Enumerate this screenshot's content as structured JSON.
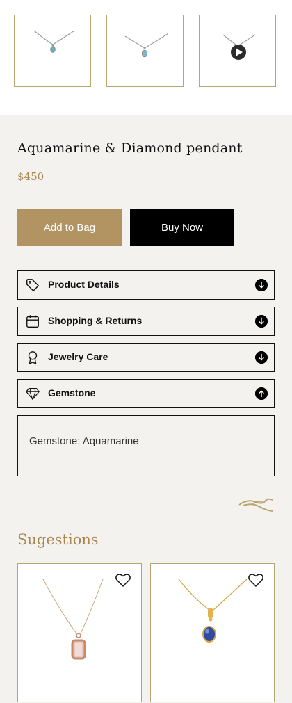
{
  "gallery": {
    "thumbnails": [
      {
        "icon": "pendant-aquamarine-front"
      },
      {
        "icon": "pendant-aquamarine-side"
      },
      {
        "icon": "play-video-icon"
      }
    ]
  },
  "product": {
    "title": "Aquamarine & Diamond pendant",
    "price": "$450"
  },
  "actions": {
    "add_to_bag": "Add to Bag",
    "buy_now": "Buy Now"
  },
  "accordion": [
    {
      "label": "Product Details",
      "icon": "tag-icon",
      "expanded": false
    },
    {
      "label": "Shopping & Returns",
      "icon": "calendar-icon",
      "expanded": false
    },
    {
      "label": "Jewelry Care",
      "icon": "award-icon",
      "expanded": false
    },
    {
      "label": "Gemstone",
      "icon": "diamond-icon",
      "expanded": true
    }
  ],
  "gemstone_panel": {
    "text": "Gemstone: Aquamarine"
  },
  "suggestions": {
    "title": "Sugestions",
    "items": [
      {
        "icon": "heart-icon"
      },
      {
        "icon": "heart-icon"
      }
    ]
  },
  "colors": {
    "gold": "#b19461",
    "gold_text": "#a98650",
    "border_gold": "#b9a570",
    "background": "#f4f2ee"
  }
}
